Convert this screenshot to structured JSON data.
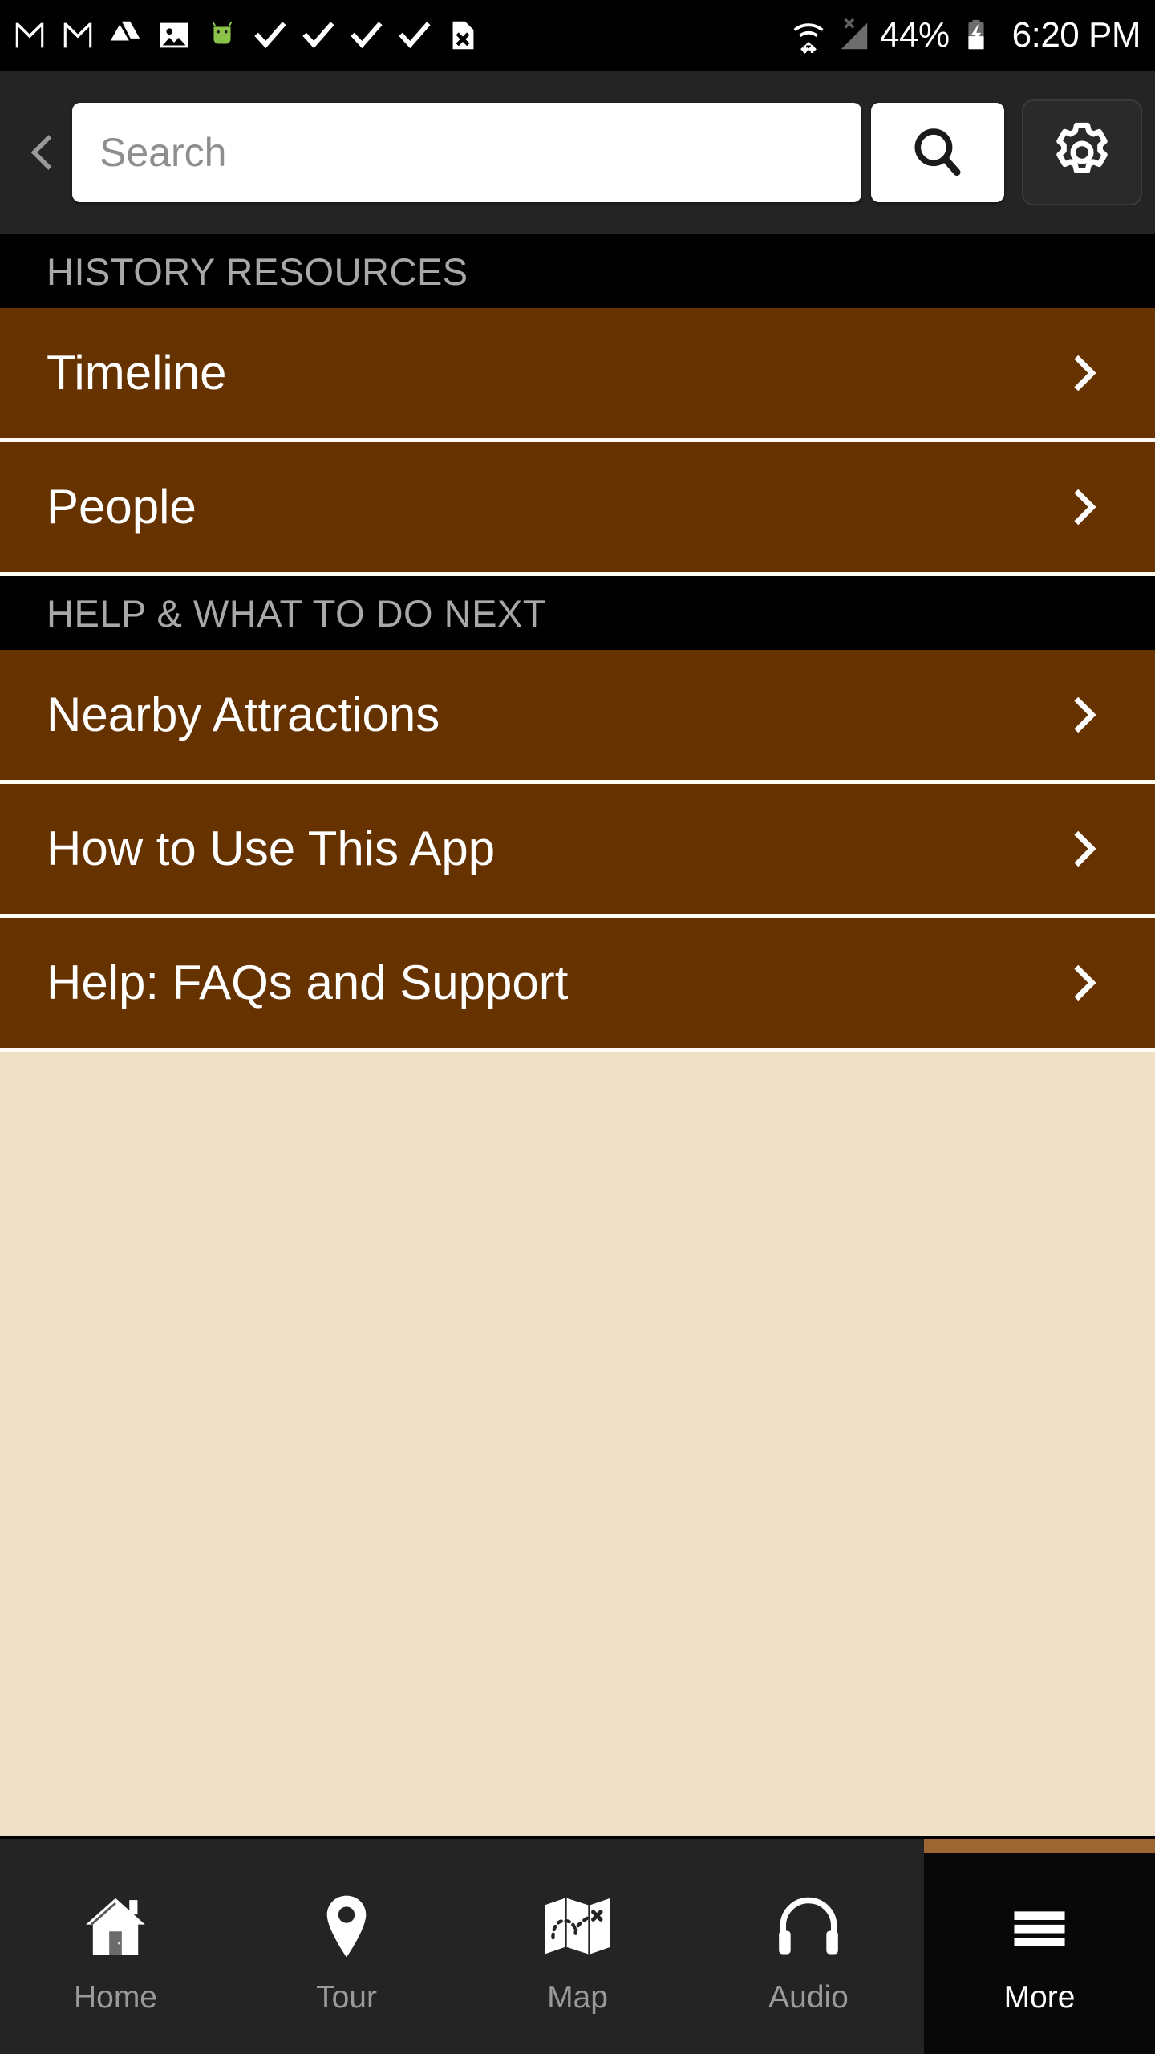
{
  "status_bar": {
    "left_icons": [
      {
        "name": "gmail-icon"
      },
      {
        "name": "gmail-icon"
      },
      {
        "name": "google-drive-icon"
      },
      {
        "name": "photos-icon"
      },
      {
        "name": "android-robot-icon"
      },
      {
        "name": "checkmark-icon"
      },
      {
        "name": "checkmark-icon"
      },
      {
        "name": "checkmark-icon"
      },
      {
        "name": "checkmark-icon"
      },
      {
        "name": "document-error-icon"
      }
    ],
    "wifi_icon": "wifi-no-internet-icon",
    "signal_icon": "cellular-signal-off-icon",
    "battery_percent": "44%",
    "battery_icon": "battery-charging-icon",
    "time": "6:20 PM"
  },
  "toolbar": {
    "back_icon": "chevron-left-icon",
    "search_placeholder": "Search",
    "search_value": "",
    "search_button_icon": "search-icon",
    "settings_button_icon": "gear-icon"
  },
  "sections": [
    {
      "header": "HISTORY RESOURCES",
      "items": [
        {
          "label": "Timeline",
          "chevron": "chevron-right-icon"
        },
        {
          "label": "People",
          "chevron": "chevron-right-icon"
        }
      ]
    },
    {
      "header": "HELP & WHAT TO DO NEXT",
      "items": [
        {
          "label": "Nearby Attractions",
          "chevron": "chevron-right-icon"
        },
        {
          "label": "How to Use This App",
          "chevron": "chevron-right-icon"
        },
        {
          "label": "Help: FAQs and Support",
          "chevron": "chevron-right-icon"
        }
      ]
    }
  ],
  "bottom_nav": {
    "items": [
      {
        "label": "Home",
        "icon": "home-icon",
        "active": false
      },
      {
        "label": "Tour",
        "icon": "map-pin-icon",
        "active": false
      },
      {
        "label": "Map",
        "icon": "folded-map-icon",
        "active": false
      },
      {
        "label": "Audio",
        "icon": "headphones-icon",
        "active": false
      },
      {
        "label": "More",
        "icon": "hamburger-menu-icon",
        "active": true
      }
    ]
  },
  "colors": {
    "row_brown": "#663300",
    "page_cream": "#EFE1C6",
    "toolbar_dark": "#242424",
    "section_header_black": "#000000",
    "active_tab_accent": "#9D6632",
    "divider_white": "#FFFDF5"
  }
}
